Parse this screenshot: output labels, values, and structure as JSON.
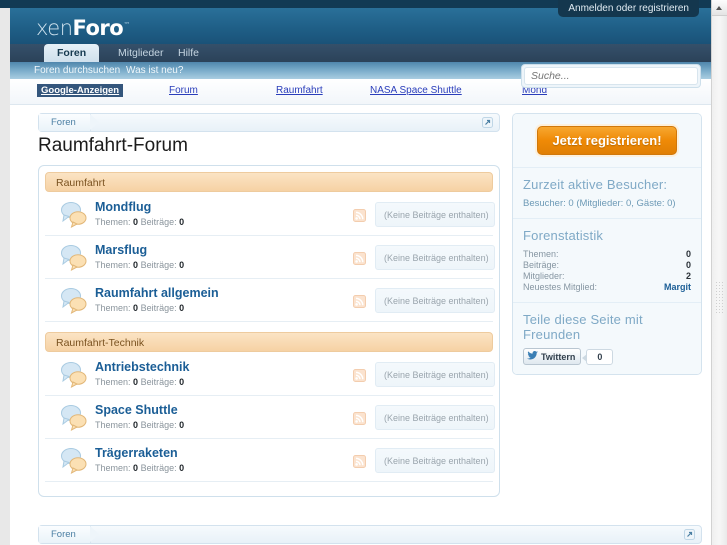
{
  "header": {
    "logo_thin": "xen",
    "logo_bold": "Foro",
    "logo_tm": "™",
    "login_label": "Anmelden oder registrieren",
    "tabs": [
      {
        "label": "Foren",
        "active": true
      },
      {
        "label": "Mitglieder",
        "active": false
      },
      {
        "label": "Hilfe",
        "active": false
      }
    ],
    "subnav": [
      {
        "label": "Foren durchsuchen"
      },
      {
        "label": "Was ist neu?"
      }
    ]
  },
  "search": {
    "placeholder": "Suche...",
    "value": ""
  },
  "ads": {
    "label": "Google-Anzeigen",
    "links": [
      "Forum",
      "Raumfahrt",
      "NASA Space Shuttle",
      "Mond"
    ]
  },
  "breadcrumb": {
    "crumb": "Foren"
  },
  "page": {
    "title": "Raumfahrt-Forum"
  },
  "forum": {
    "categories": [
      {
        "title": "Raumfahrt",
        "nodes": [
          {
            "title": "Mondflug",
            "threads_label": "Themen:",
            "threads": "0",
            "posts_label": "Beiträge:",
            "posts": "0",
            "last_post": "(Keine Beiträge enthalten)"
          },
          {
            "title": "Marsflug",
            "threads_label": "Themen:",
            "threads": "0",
            "posts_label": "Beiträge:",
            "posts": "0",
            "last_post": "(Keine Beiträge enthalten)"
          },
          {
            "title": "Raumfahrt allgemein",
            "threads_label": "Themen:",
            "threads": "0",
            "posts_label": "Beiträge:",
            "posts": "0",
            "last_post": "(Keine Beiträge enthalten)"
          }
        ]
      },
      {
        "title": "Raumfahrt-Technik",
        "nodes": [
          {
            "title": "Antriebstechnik",
            "threads_label": "Themen:",
            "threads": "0",
            "posts_label": "Beiträge:",
            "posts": "0",
            "last_post": "(Keine Beiträge enthalten)"
          },
          {
            "title": "Space Shuttle",
            "threads_label": "Themen:",
            "threads": "0",
            "posts_label": "Beiträge:",
            "posts": "0",
            "last_post": "(Keine Beiträge enthalten)"
          },
          {
            "title": "Trägerraketen",
            "threads_label": "Themen:",
            "threads": "0",
            "posts_label": "Beiträge:",
            "posts": "0",
            "last_post": "(Keine Beiträge enthalten)"
          }
        ]
      }
    ]
  },
  "sidebar": {
    "register_label": "Jetzt registrieren!",
    "visitors": {
      "heading": "Zurzeit aktive Besucher:",
      "text": "Besucher: 0 (Mitglieder: 0, Gäste: 0)"
    },
    "stats": {
      "heading": "Forenstatistik",
      "rows": [
        {
          "label": "Themen:",
          "value": "0",
          "is_link": false
        },
        {
          "label": "Beiträge:",
          "value": "0",
          "is_link": false
        },
        {
          "label": "Mitglieder:",
          "value": "2",
          "is_link": false
        },
        {
          "label": "Neuestes Mitglied:",
          "value": "Margit",
          "is_link": true
        }
      ]
    },
    "share": {
      "heading": "Teile diese Seite mit Freunden",
      "tweet_label": "Twittern",
      "tweet_count": "0"
    }
  },
  "colors": {
    "header_blue": "#1f5f87",
    "navbar_dark": "#2b4259",
    "accent_orange": "#ef8a06",
    "link_blue": "#1b5e96",
    "category_peach": "#f6d2a4"
  }
}
